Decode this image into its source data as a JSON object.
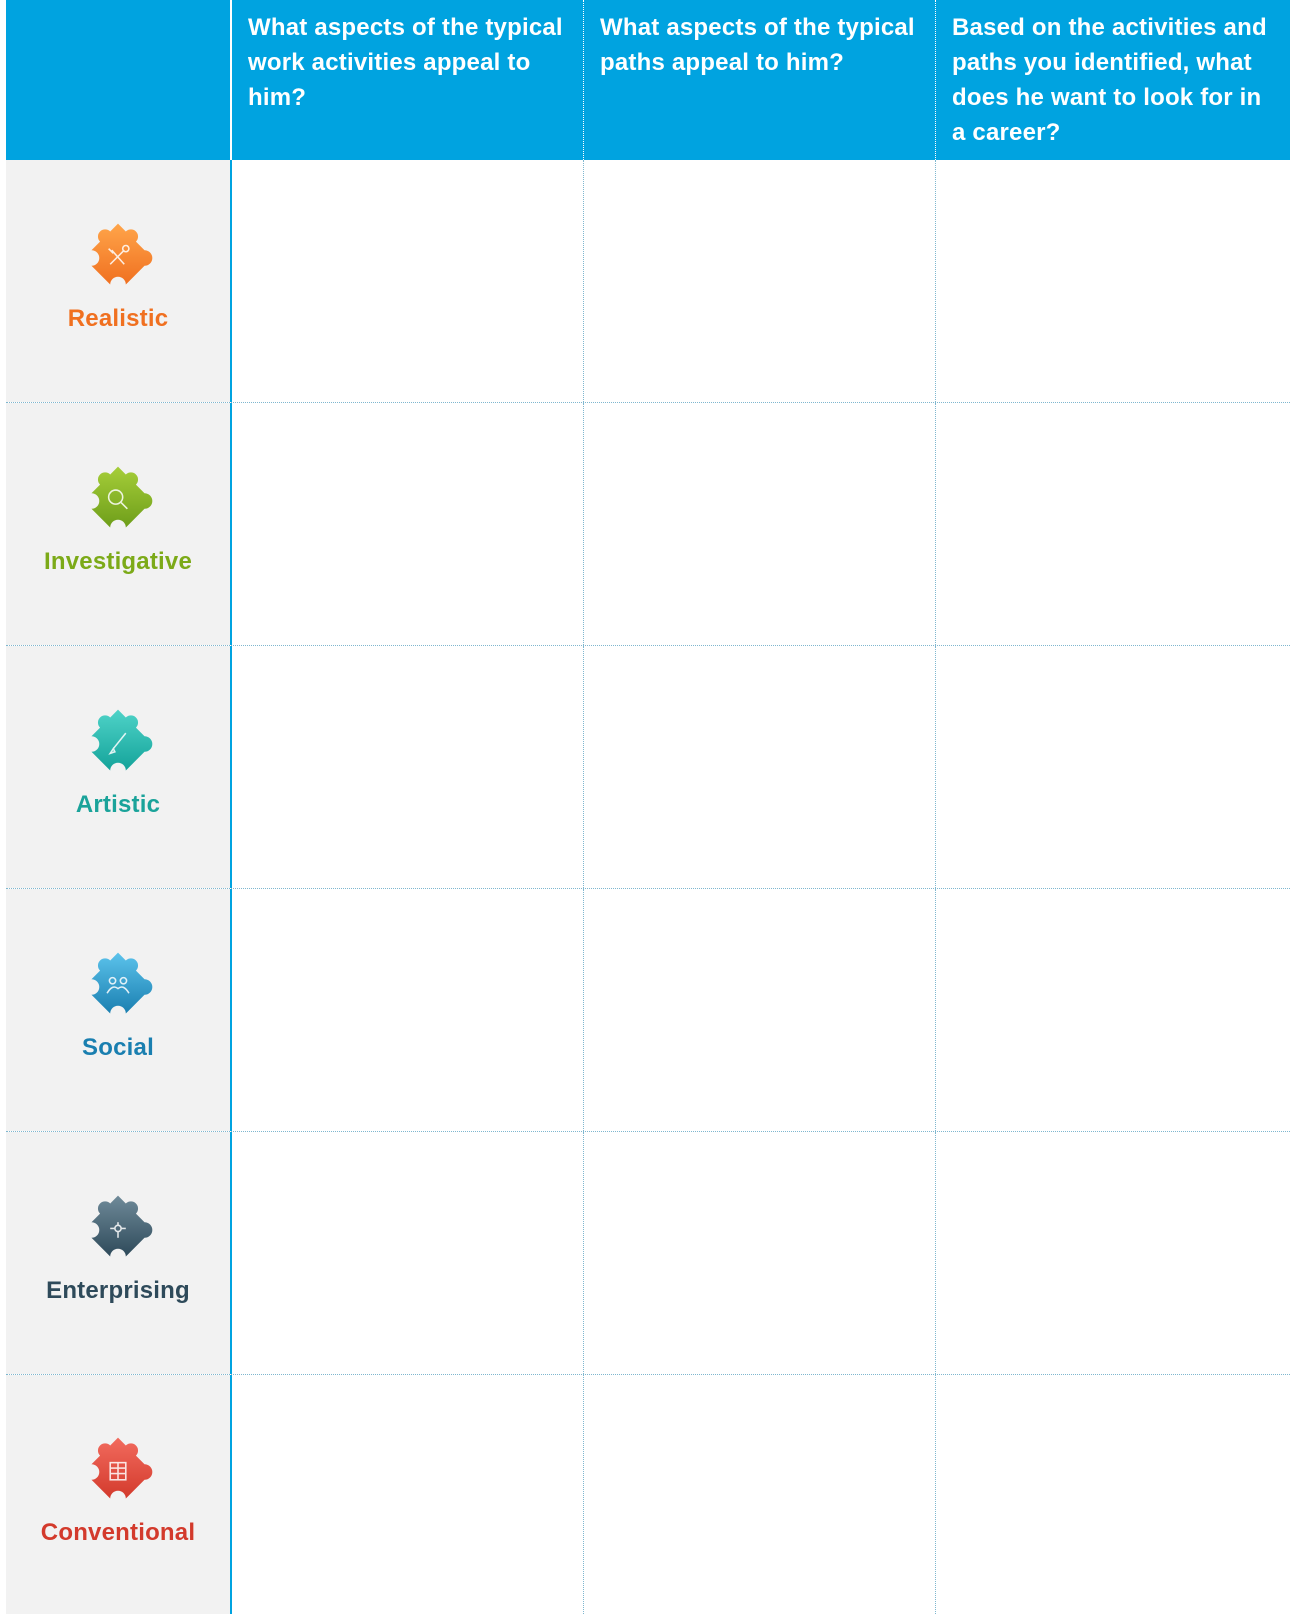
{
  "header": {
    "col1": "What aspects of the typical work activities appeal to him?",
    "col2": "What aspects of the typical paths appeal to him?",
    "col3": "Based on the activities and paths you identified, what does he want to look for in a career?"
  },
  "rows": [
    {
      "label": "Realistic",
      "icon": "tools-puzzle-icon",
      "color": "#F07020"
    },
    {
      "label": "Investigative",
      "icon": "magnifier-puzzle-icon",
      "color": "#7CAA18"
    },
    {
      "label": "Artistic",
      "icon": "paintbrush-puzzle-icon",
      "color": "#1AA39A"
    },
    {
      "label": "Social",
      "icon": "people-puzzle-icon",
      "color": "#1A7FB0"
    },
    {
      "label": "Enterprising",
      "icon": "network-puzzle-icon",
      "color": "#2E4A5A"
    },
    {
      "label": "Conventional",
      "icon": "grid-puzzle-icon",
      "color": "#D33A2C"
    }
  ],
  "colors": {
    "header_bg": "#00A3E0",
    "label_bg": "#F2F2F2"
  }
}
